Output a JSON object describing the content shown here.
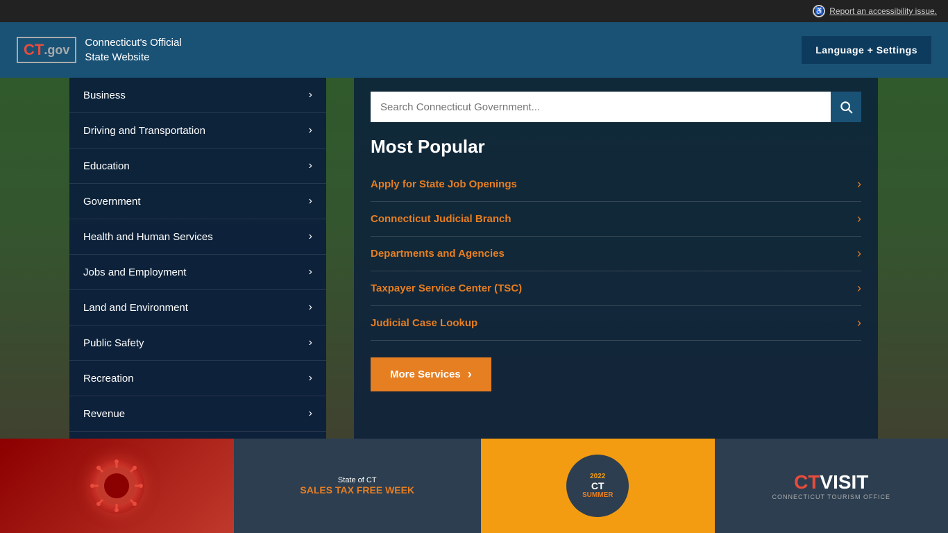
{
  "topbar": {
    "accessibility_label": "Report an accessibility issue."
  },
  "header": {
    "logo_ct": "CT",
    "logo_dot": ".",
    "logo_gov": "gov",
    "site_title_line1": "Connecticut's Official",
    "site_title_line2": "State Website",
    "lang_btn": "Language + Settings"
  },
  "nav": {
    "items": [
      {
        "label": "Business",
        "id": "business"
      },
      {
        "label": "Driving and Transportation",
        "id": "driving"
      },
      {
        "label": "Education",
        "id": "education"
      },
      {
        "label": "Government",
        "id": "government"
      },
      {
        "label": "Health and Human Services",
        "id": "health"
      },
      {
        "label": "Jobs and Employment",
        "id": "jobs"
      },
      {
        "label": "Land and Environment",
        "id": "land"
      },
      {
        "label": "Public Safety",
        "id": "public-safety"
      },
      {
        "label": "Recreation",
        "id": "recreation"
      },
      {
        "label": "Revenue",
        "id": "revenue"
      }
    ]
  },
  "search": {
    "placeholder": "Search Connecticut Government...",
    "btn_label": "🔍"
  },
  "popular": {
    "title": "Most Popular",
    "items": [
      {
        "label": "Apply for State Job Openings"
      },
      {
        "label": "Connecticut Judicial Branch"
      },
      {
        "label": "Departments and Agencies"
      },
      {
        "label": "Taxpayer Service Center (TSC)"
      },
      {
        "label": "Judicial Case Lookup"
      }
    ],
    "more_btn": "More Services"
  },
  "cards": [
    {
      "id": "card-covid",
      "type": "virus"
    },
    {
      "id": "card-sales",
      "type": "sales",
      "line1": "State of CT",
      "line2": "SALES TAX FREE WEEK"
    },
    {
      "id": "card-summer",
      "type": "summer",
      "year": "2022",
      "ct": "CT",
      "summer": "SUMMER"
    },
    {
      "id": "card-ctvisit",
      "type": "ctvisit",
      "ct": "CT",
      "visit": "VISIT",
      "sub": "CONNECTICUT TOURISM OFFICE"
    }
  ]
}
